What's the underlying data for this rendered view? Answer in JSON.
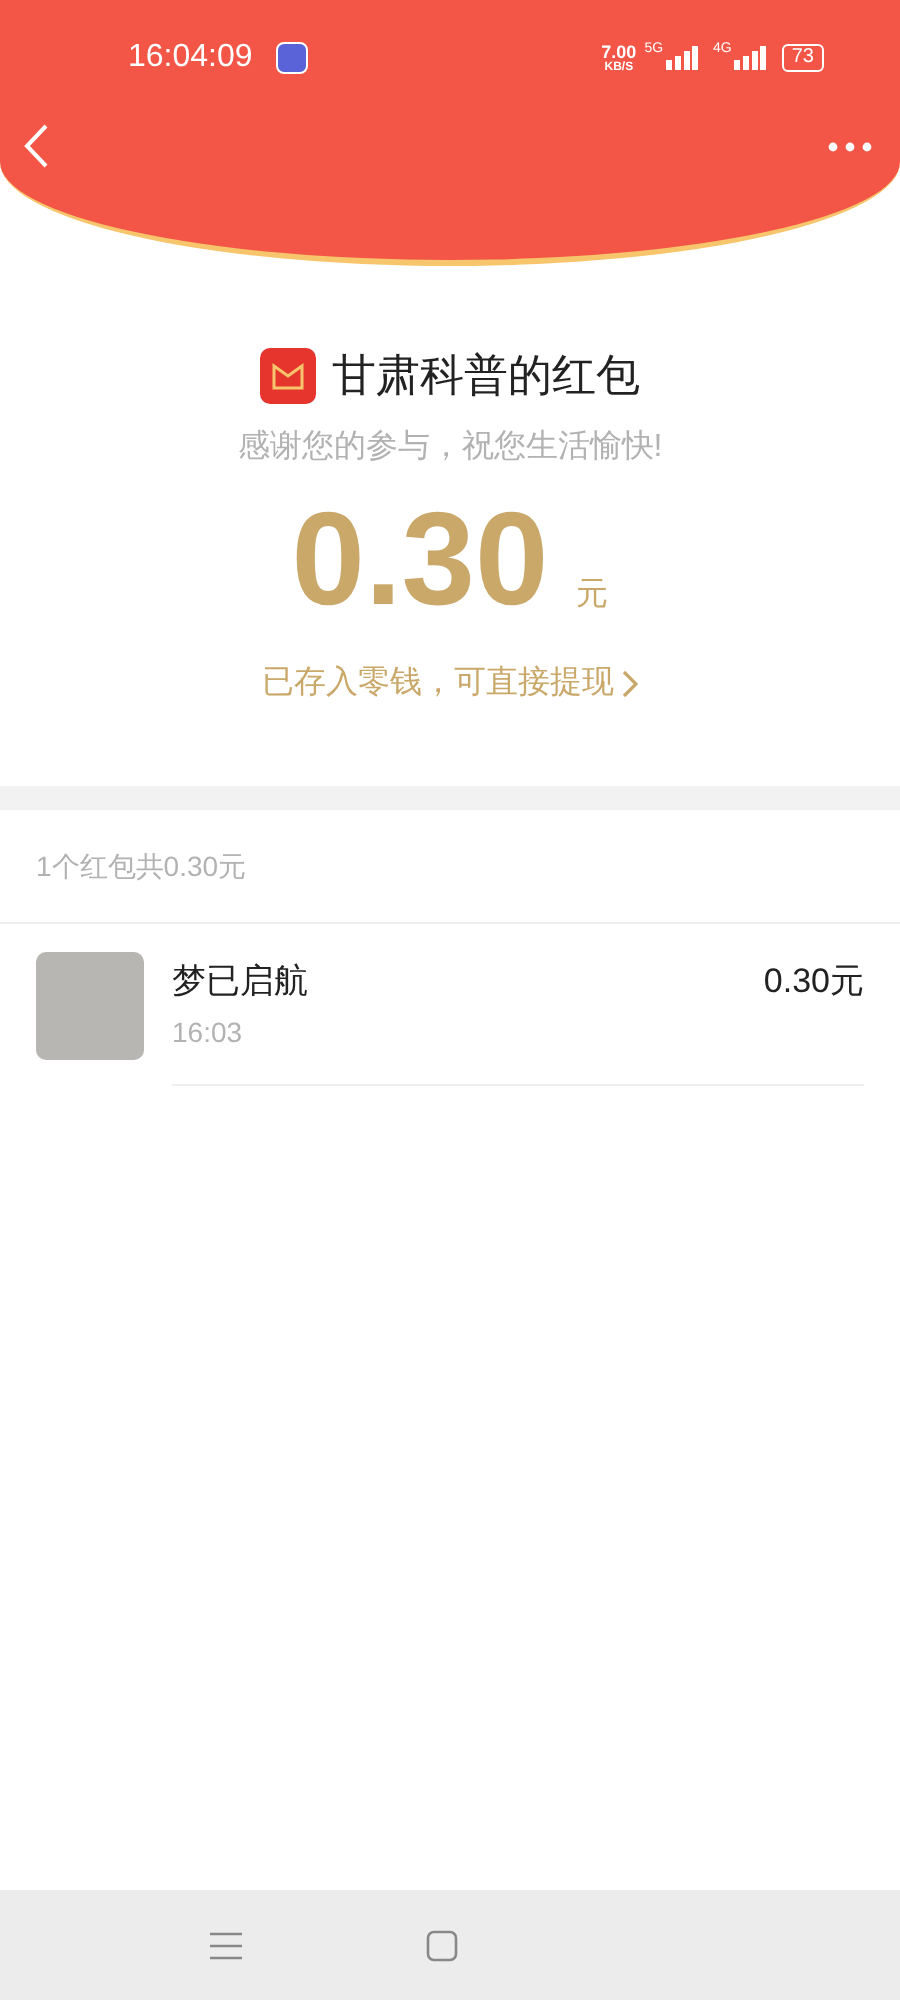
{
  "status_bar": {
    "time": "16:04:09",
    "net_speed": "7.00",
    "net_unit": "KB/S",
    "network_1": "5G",
    "network_2": "4G",
    "battery": "73"
  },
  "packet": {
    "title": "甘肃科普的红包",
    "greeting": "感谢您的参与，祝您生活愉快!",
    "amount": "0.30",
    "unit": "元",
    "note": "已存入零钱，可直接提现"
  },
  "list": {
    "summary": "1个红包共0.30元",
    "rows": [
      {
        "name": "梦已启航",
        "time": "16:03",
        "amount": "0.30元"
      }
    ]
  }
}
